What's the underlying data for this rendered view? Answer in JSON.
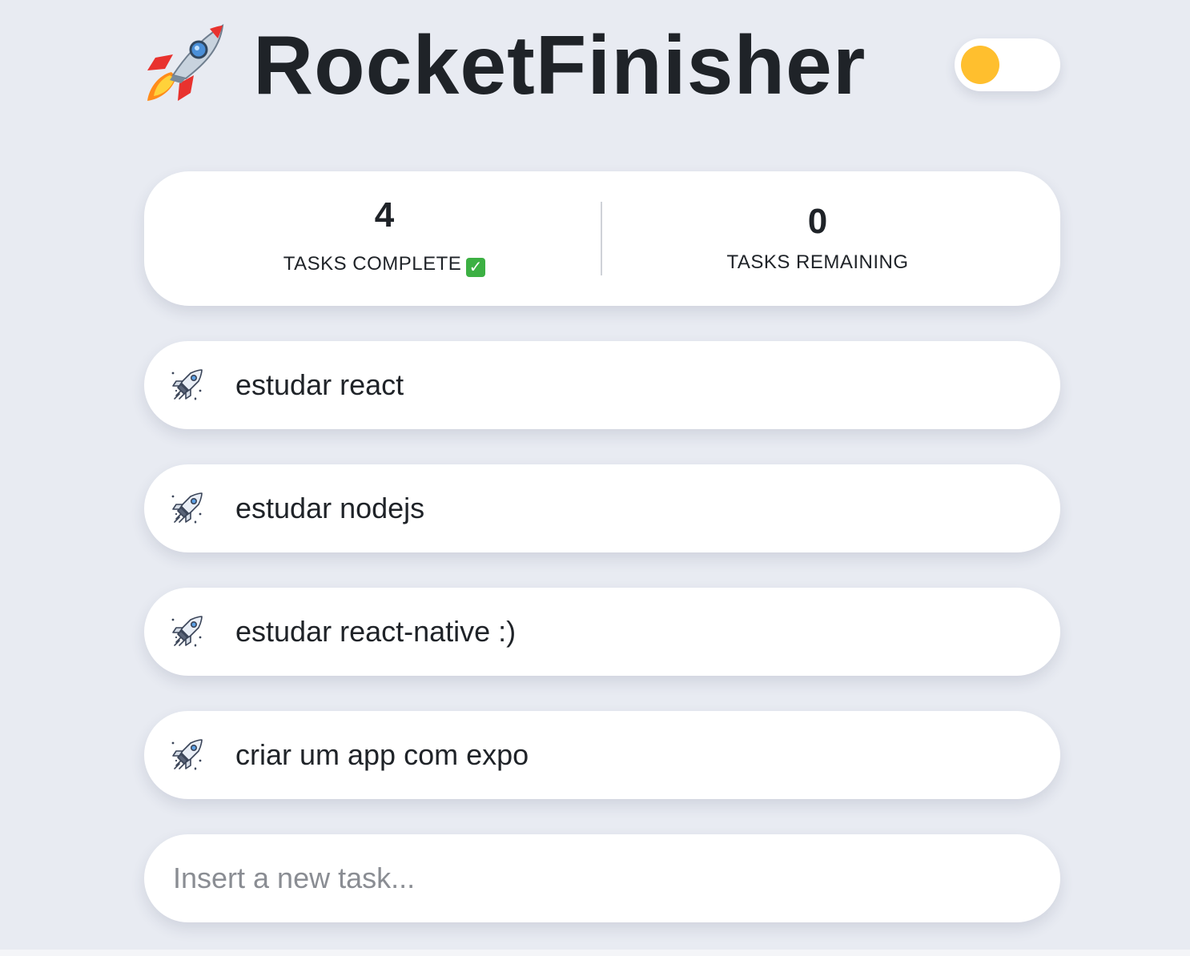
{
  "app": {
    "title": "RocketFinisher",
    "logo_icon": "rocket-icon",
    "theme_toggle": {
      "state": "off",
      "knob_color": "#ffbf2e"
    }
  },
  "stats": {
    "complete": {
      "count": "4",
      "label": "TASKS COMPLETE",
      "badge_icon": "check-mark-icon"
    },
    "remaining": {
      "count": "0",
      "label": "TASKS REMAINING"
    }
  },
  "tasks": [
    {
      "label": "estudar react",
      "icon": "rocket-outline-icon"
    },
    {
      "label": "estudar nodejs",
      "icon": "rocket-outline-icon"
    },
    {
      "label": "estudar react-native :)",
      "icon": "rocket-outline-icon"
    },
    {
      "label": "criar um app com expo",
      "icon": "rocket-outline-icon"
    }
  ],
  "new_task": {
    "placeholder": "Insert a new task...",
    "value": ""
  },
  "colors": {
    "background": "#e8ebf2",
    "card": "#ffffff",
    "text": "#1f2328",
    "accent": "#ffbf2e",
    "check": "#3cb043"
  }
}
